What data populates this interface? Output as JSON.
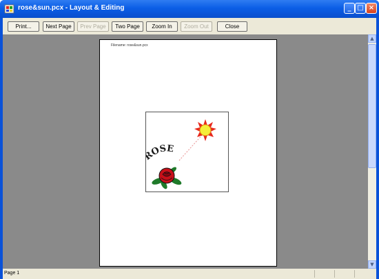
{
  "window": {
    "title": "rose&sun.pcx - Layout & Editing",
    "minimize_glyph": "_",
    "maximize_glyph": "□",
    "close_glyph": "×",
    "app_icon": "paint-app-icon"
  },
  "toolbar": {
    "print_label": "Print...",
    "next_page_label": "Next Page",
    "prev_page_label": "Prev Page",
    "two_page_label": "Two Page",
    "zoom_in_label": "Zoom In",
    "zoom_out_label": "Zoom Out",
    "close_label": "Close"
  },
  "page": {
    "header_text": "Filename: rose&sun.pcx",
    "image_word": "ROSE",
    "image_content": [
      "rose-icon",
      "sun-icon"
    ]
  },
  "scrollbar": {
    "up_glyph": "▲",
    "down_glyph": "▼"
  },
  "status": {
    "page_label": "Page 1"
  },
  "colors": {
    "titlebar": "#0a53d6",
    "workarea": "#8a8a8a",
    "sun_rays": "#e8281c",
    "sun_center": "#f5ee3a",
    "rose_red": "#c8101a",
    "leaf_green": "#1f7a2a"
  }
}
